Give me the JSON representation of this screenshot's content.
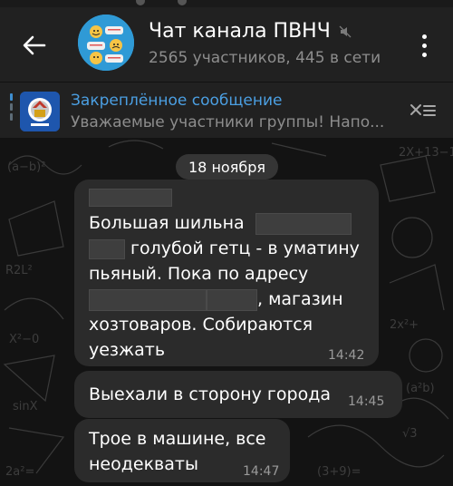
{
  "header": {
    "title": "Чат канала ПВНЧ",
    "subtitle": "2565 участников, 445 в сети"
  },
  "pinned": {
    "title": "Закреплённое сообщение",
    "text": "Уважаемые участники группы! Напо..."
  },
  "chat": {
    "date_label": "18 ноября",
    "messages": [
      {
        "line1": "Большая шильна",
        "line2": "голубой гетц - в уматину",
        "line3": "пьяный. Пока по адресу",
        "line4": ", магазин",
        "line5": "хозтоваров. Собираются",
        "line6": "уезжать",
        "time": "14:42"
      },
      {
        "text": "Выехали в сторону города",
        "time": "14:45"
      },
      {
        "line1": "Трое в машине, все",
        "line2": "неодекваты",
        "time": "14:47"
      }
    ]
  },
  "colors": {
    "header_bg": "#212121",
    "accent": "#4b9fe2",
    "bubble_bg": "#2b2b2b",
    "secondary_text": "#8d8d8d"
  },
  "icons": [
    "back-arrow-icon",
    "muted-icon",
    "more-vertical-icon",
    "unpin-icon"
  ]
}
